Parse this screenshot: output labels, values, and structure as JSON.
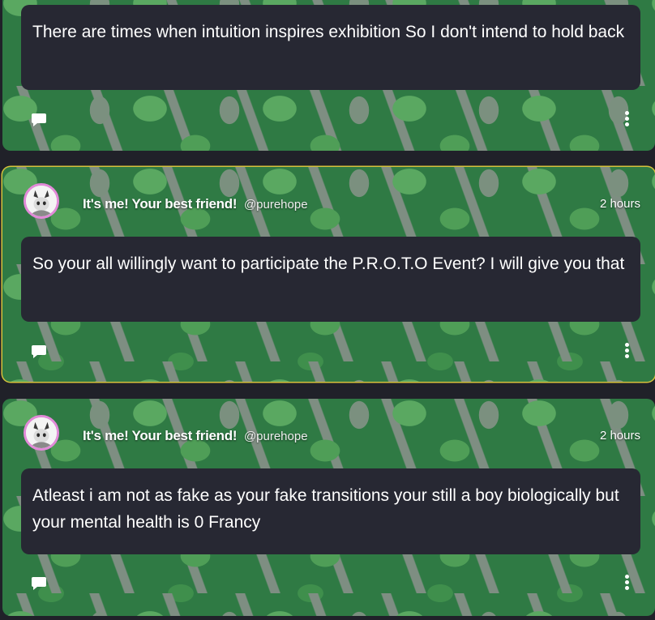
{
  "posts": [
    {
      "text": "There are times when intuition inspires exhibition So I don't intend to hold back"
    },
    {
      "display_name": "It's me! Your best friend!",
      "handle": "@purehope",
      "time": "2 hours",
      "text": "So your all willingly want to participate the P.R.O.T.O Event? I will give you that"
    },
    {
      "display_name": "It's me! Your best friend!",
      "handle": "@purehope",
      "time": "2 hours",
      "text": "Atleast i am not as fake as your fake transitions your still a boy biologically but your mental health is 0 Francy"
    }
  ],
  "icons": {
    "comment": "comment-icon",
    "menu": "more-options-icon",
    "avatar": "avatar"
  },
  "colors": {
    "page_bg": "#202129",
    "bubble_bg": "#272833",
    "highlight_border": "#d6c23c",
    "avatar_ring": "#e28ad8"
  }
}
